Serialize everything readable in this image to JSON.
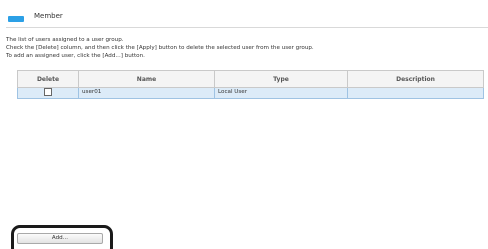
{
  "section": {
    "title": "Member",
    "marker_color": "#2ca0e6"
  },
  "instructions": [
    "The list of users assigned to a user group.",
    "Check the [Delete] column, and then click the [Apply] button to delete the selected user from the user group.",
    "To add an assigned user, click the [Add...] button."
  ],
  "table": {
    "columns": [
      "Delete",
      "Name",
      "Type",
      "Description"
    ],
    "rows": [
      {
        "delete_checked": false,
        "name": "user01",
        "type": "Local User",
        "description": ""
      }
    ],
    "selected_row_color": "#dcebf8"
  },
  "add_button": {
    "label": "Add..."
  }
}
